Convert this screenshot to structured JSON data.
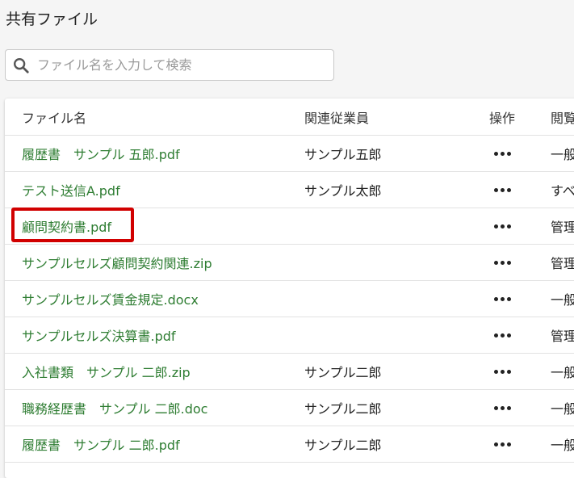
{
  "page": {
    "title": "共有ファイル"
  },
  "search": {
    "placeholder": "ファイル名を入力して検索",
    "value": ""
  },
  "table": {
    "columns": {
      "name": "ファイル名",
      "employee": "関連従業員",
      "operation": "操作",
      "permission": "閲覧"
    },
    "rows": [
      {
        "name": "履歴書　サンプル 五郎.pdf",
        "employee": "サンプル五郎",
        "permission": "一般"
      },
      {
        "name": "テスト送信A.pdf",
        "employee": "サンプル太郎",
        "permission": "すべ"
      },
      {
        "name": "顧問契約書.pdf",
        "employee": "",
        "permission": "管理"
      },
      {
        "name": "サンプルセルズ顧問契約関連.zip",
        "employee": "",
        "permission": "管理"
      },
      {
        "name": "サンプルセルズ賃金規定.docx",
        "employee": "",
        "permission": "一般"
      },
      {
        "name": "サンプルセルズ決算書.pdf",
        "employee": "",
        "permission": "管理"
      },
      {
        "name": "入社書類　サンプル 二郎.zip",
        "employee": "サンプル二郎",
        "permission": "一般"
      },
      {
        "name": "職務経歴書　サンプル 二郎.doc",
        "employee": "サンプル二郎",
        "permission": "一般"
      },
      {
        "name": "履歴書　サンプル 二郎.pdf",
        "employee": "サンプル二郎",
        "permission": "一般"
      }
    ]
  },
  "colors": {
    "link": "#2e7d32",
    "highlight": "#d10000",
    "background": "#f5f5f5"
  },
  "icons": {
    "search": "search-icon",
    "row_menu": "more-horizontal-icon"
  }
}
